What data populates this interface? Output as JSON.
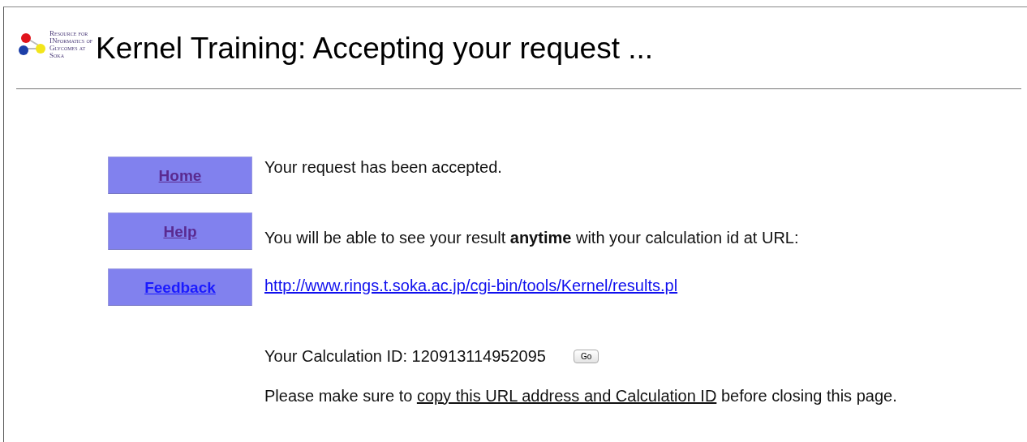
{
  "logo": {
    "lines": [
      "Resource for",
      "INformatics of",
      "Glycomes at",
      "Soka"
    ]
  },
  "title": "Kernel Training: Accepting your request ...",
  "nav": [
    {
      "label": "Home",
      "visited": true
    },
    {
      "label": "Help",
      "visited": true
    },
    {
      "label": "Feedback",
      "visited": false
    }
  ],
  "message": "Your request has been accepted.",
  "info": "You will be able to see your result **anytime** with your calculation id at URL:",
  "result_url": "http://www.rings.t.soka.ac.jp/cgi-bin/tools/Kernel/results.pl",
  "calculation_id": "Your Calculation ID: 120913114952095",
  "go_button": "Go",
  "notice": {
    "before": "Please make sure to ",
    "underlined": "copy this URL address and Calculation ID",
    "after": " before closing this page."
  }
}
